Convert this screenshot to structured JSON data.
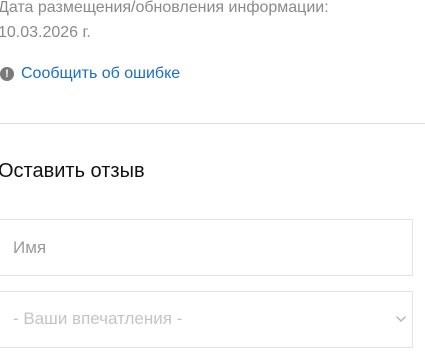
{
  "info": {
    "date_label": "Дата размещения/обновления информации:",
    "date_value": "10.03.2026 г."
  },
  "report": {
    "icon": "exclamation-icon",
    "icon_glyph": "!",
    "label": "Сообщить об ошибке",
    "color": "#1a6fc4"
  },
  "review": {
    "title": "Оставить отзыв",
    "name_placeholder": "Имя",
    "impressions_placeholder": "- Ваши впечатления -",
    "impressions_icon": "chevron-down-icon"
  }
}
